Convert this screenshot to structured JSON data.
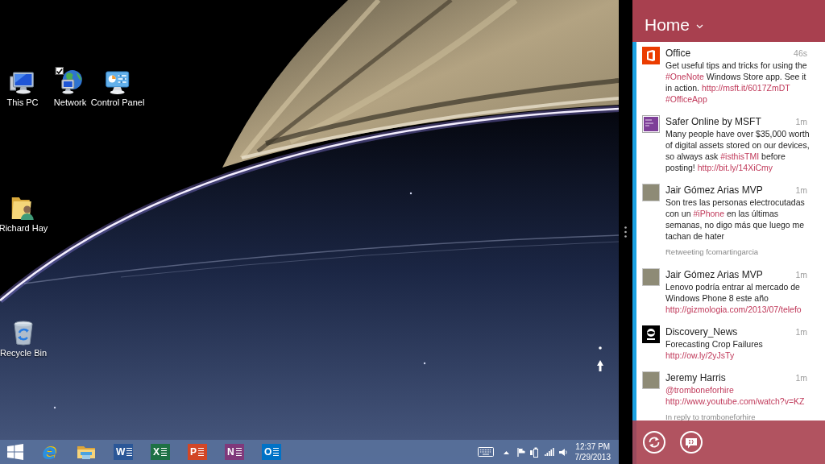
{
  "desktop": {
    "icons": [
      {
        "label": "This PC",
        "kind": "computer",
        "checked": false
      },
      {
        "label": "Network",
        "kind": "network",
        "checked": true
      },
      {
        "label": "Control Panel",
        "kind": "control_panel",
        "checked": false
      },
      {
        "label": "Richard Hay",
        "kind": "user_folder",
        "checked": false
      },
      {
        "label": "Recycle Bin",
        "kind": "recycle_bin",
        "checked": false
      }
    ]
  },
  "taskbar": {
    "apps": [
      {
        "kind": "start"
      },
      {
        "kind": "browser",
        "letter": "e"
      },
      {
        "kind": "folder"
      },
      {
        "kind": "tile",
        "letter": "W",
        "color": "#2b5797"
      },
      {
        "kind": "tile",
        "letter": "X",
        "color": "#1e7145"
      },
      {
        "kind": "tile",
        "letter": "P",
        "color": "#d24726"
      },
      {
        "kind": "tile",
        "letter": "N",
        "color": "#80397b"
      },
      {
        "kind": "tile",
        "letter": "O",
        "color": "#0072c6"
      }
    ],
    "clock": {
      "time": "12:37 PM",
      "date": "7/29/2013"
    }
  },
  "feed": {
    "title": "Home",
    "tweets": [
      {
        "author": "Office",
        "time": "46s",
        "avatar": {
          "kind": "door_logo"
        },
        "body": [
          {
            "kind": "plain",
            "text": "Get useful tips and tricks for using the "
          },
          {
            "kind": "hashtag",
            "text": "#OneNote"
          },
          {
            "kind": "plain",
            "text": " Windows Store app. See it in action. "
          },
          {
            "kind": "link",
            "text": "http://msft.it/6017ZmDT"
          },
          {
            "kind": "hashtag",
            "text": "#OfficeApp"
          }
        ]
      },
      {
        "author": "Safer Online by MSFT",
        "time": "1m",
        "avatar": {
          "kind": "purple_tile"
        },
        "body": [
          {
            "kind": "plain",
            "text": "Many people have over $35,000 worth of digital assets stored on our devices, so always ask "
          },
          {
            "kind": "hashtag",
            "text": "#isthisTMI"
          },
          {
            "kind": "plain",
            "text": " before posting! "
          },
          {
            "kind": "link",
            "text": "http://bit.ly/14XiCmy"
          }
        ]
      },
      {
        "author": "Jair Gómez Arias MVP",
        "time": "1m",
        "avatar": {
          "kind": "photo"
        },
        "body": [
          {
            "kind": "plain",
            "text": "Son tres las personas electrocutadas con un "
          },
          {
            "kind": "hashtag",
            "text": "#iPhone"
          },
          {
            "kind": "plain",
            "text": " en las últimas semanas, no digo más que luego me tachan de hater"
          }
        ],
        "context": "Retweeting fcomartingarcia"
      },
      {
        "author": "Jair Gómez Arias MVP",
        "time": "1m",
        "avatar": {
          "kind": "photo"
        },
        "body": [
          {
            "kind": "plain",
            "text": "Lenovo podría entrar al mercado de Windows Phone 8 este año "
          },
          {
            "kind": "link",
            "text": "http://gizmologia.com/2013/07/telefo"
          }
        ]
      },
      {
        "author": "Discovery_News",
        "time": "1m",
        "avatar": {
          "kind": "globe_logo"
        },
        "body": [
          {
            "kind": "plain",
            "text": "Forecasting Crop Failures "
          },
          {
            "kind": "link",
            "text": "http://ow.ly/2yJsTy"
          }
        ]
      },
      {
        "author": "Jeremy Harris",
        "time": "1m",
        "avatar": {
          "kind": "photo"
        },
        "body": [
          {
            "kind": "mention",
            "text": "@tromboneforhire"
          },
          {
            "kind": "link",
            "text": "http://www.youtube.com/watch?v=KZ"
          }
        ],
        "context": "In reply to tromboneforhire"
      }
    ]
  }
}
